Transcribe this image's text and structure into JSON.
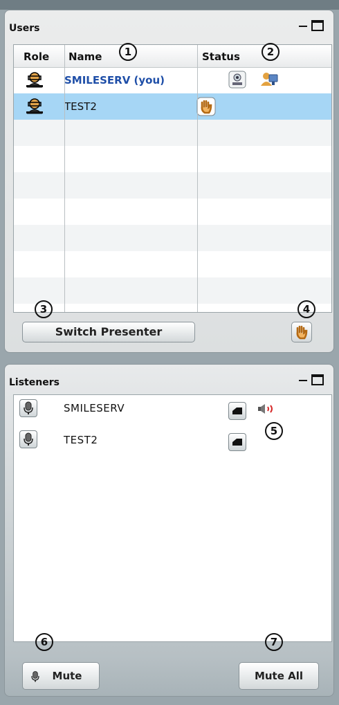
{
  "users_panel": {
    "title": "Users",
    "columns": {
      "role": "Role",
      "name": "Name",
      "status": "Status"
    },
    "rows": [
      {
        "name": "SMILESERV (you)",
        "selected": false,
        "status_icons": [
          "webcam-icon",
          "presenter-icon"
        ]
      },
      {
        "name": "TEST2",
        "selected": true,
        "status_icons": [
          "raise-hand-icon"
        ]
      }
    ],
    "switch_presenter_label": "Switch Presenter"
  },
  "listeners_panel": {
    "title": "Listeners",
    "listeners": [
      {
        "name": "SMILESERV",
        "speaking": true
      },
      {
        "name": "TEST2",
        "speaking": false
      }
    ],
    "mute_label": "Mute",
    "mute_all_label": "Mute All"
  },
  "annotations": [
    "1",
    "2",
    "3",
    "4",
    "5",
    "6",
    "7"
  ],
  "colors": {
    "selected_row": "#a6d6f5",
    "current_user": "#1f4fa8",
    "speaker_waves": "#d62a2a"
  }
}
